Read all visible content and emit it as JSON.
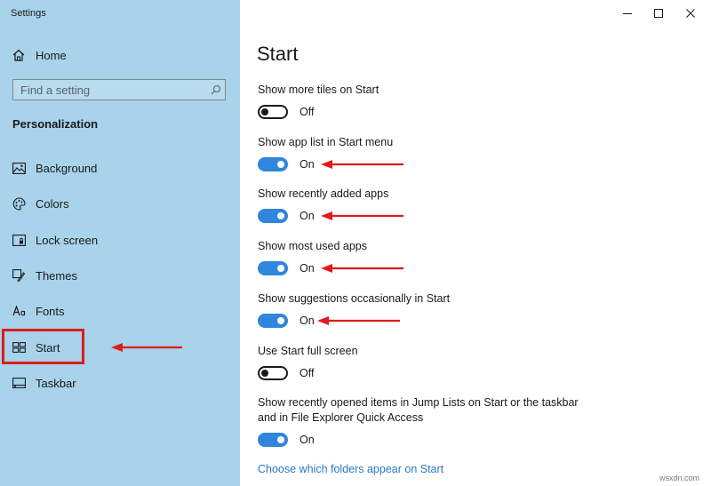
{
  "window": {
    "title": "Settings",
    "minimize_icon": "minimize-icon",
    "maximize_icon": "maximize-icon",
    "close_icon": "close-icon"
  },
  "sidebar": {
    "home_label": "Home",
    "search_placeholder": "Find a setting",
    "section_title": "Personalization",
    "items": [
      {
        "label": "Background",
        "icon": "picture-icon"
      },
      {
        "label": "Colors",
        "icon": "palette-icon"
      },
      {
        "label": "Lock screen",
        "icon": "lock-screen-icon"
      },
      {
        "label": "Themes",
        "icon": "brush-icon"
      },
      {
        "label": "Fonts",
        "icon": "font-icon"
      },
      {
        "label": "Start",
        "icon": "start-menu-icon",
        "selected": true
      },
      {
        "label": "Taskbar",
        "icon": "taskbar-icon"
      }
    ]
  },
  "main": {
    "heading": "Start",
    "settings": [
      {
        "label": "Show more tiles on Start",
        "state": "Off",
        "on": false
      },
      {
        "label": "Show app list in Start menu",
        "state": "On",
        "on": true
      },
      {
        "label": "Show recently added apps",
        "state": "On",
        "on": true
      },
      {
        "label": "Show most used apps",
        "state": "On",
        "on": true
      },
      {
        "label": "Show suggestions occasionally in Start",
        "state": "On",
        "on": true
      },
      {
        "label": "Use Start full screen",
        "state": "Off",
        "on": false
      },
      {
        "label_line1": "Show recently opened items in Jump Lists on Start or the taskbar",
        "label_line2": "and in File Explorer Quick Access",
        "state": "On",
        "on": true
      }
    ],
    "link": "Choose which folders appear on Start"
  },
  "colors": {
    "sidebar_bg": "#a8d3ea",
    "toggle_on": "#2f86dc",
    "link": "#2b79c4",
    "annotation_red": "#e01b1b"
  },
  "watermark": "wsxdn.com"
}
